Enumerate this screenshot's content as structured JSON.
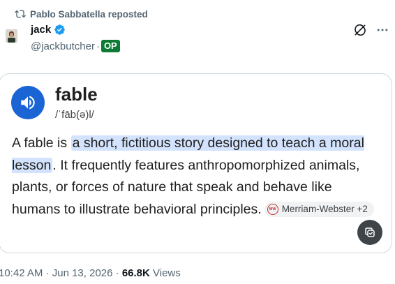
{
  "repost": {
    "text": "Pablo Sabbatella reposted",
    "icon": "repost-icon"
  },
  "author": {
    "name": "jack",
    "handle": "@jackbutcher",
    "separator": "·",
    "badge": "OP",
    "verified_icon": "verified-badge-icon",
    "avatar_icon": "avatar"
  },
  "actions": {
    "grok_icon": "grok-icon",
    "more_icon": "more-options-icon"
  },
  "card": {
    "word": "fable",
    "pronunciation": "/ˈfāb(ə)l/",
    "speaker_icon": "speaker-icon",
    "definition": {
      "lead": "A fable is ",
      "highlight": "a short, fictitious story designed to teach a moral lesson",
      "rest": ". It frequently features anthropomorphized animals, plants, or forces of nature that speak and behave like humans to illustrate behavioral principles."
    },
    "source": {
      "label": "Merriam-Webster +2",
      "logo_text": "MW"
    },
    "copy_icon": "copy-icon"
  },
  "meta": {
    "time": "10:42 AM",
    "dot1": " · ",
    "date": "Jun 13, 2026",
    "dot2": " · ",
    "views_count": "66.8K",
    "views_label": " Views"
  },
  "colors": {
    "accent_blue": "#1a64d4",
    "highlight": "#d3e3fd",
    "op_green": "#0e7a33",
    "verified_blue": "#1d9bf0",
    "muted": "#536471"
  }
}
